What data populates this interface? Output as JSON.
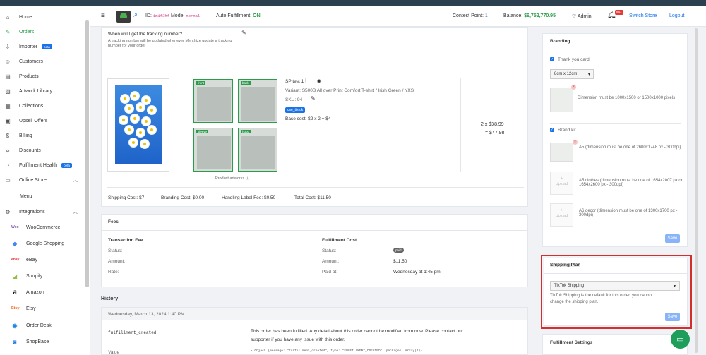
{
  "sidebar": {
    "items": [
      {
        "label": "Home",
        "icon": "home-icon"
      },
      {
        "label": "Orders",
        "icon": "edit-icon",
        "active": true
      },
      {
        "label": "Importer",
        "icon": "import-icon",
        "badge": "beta"
      },
      {
        "label": "Customers",
        "icon": "user-icon"
      },
      {
        "label": "Products",
        "icon": "box-icon"
      },
      {
        "label": "Artwork Library",
        "icon": "image-icon"
      },
      {
        "label": "Collections",
        "icon": "collection-icon"
      },
      {
        "label": "Upsell Offers",
        "icon": "cart-icon"
      },
      {
        "label": "Billing",
        "icon": "dollar-icon"
      },
      {
        "label": "Discounts",
        "icon": "tag-icon"
      },
      {
        "label": "Fulfillment Health",
        "icon": "health-icon",
        "badge": "beta"
      },
      {
        "label": "Online Store",
        "icon": "store-icon",
        "expanded": true
      },
      {
        "label": "Menu",
        "sub": true
      },
      {
        "label": "Integrations",
        "icon": "integrations-icon",
        "expanded": true
      },
      {
        "label": "WooCommerce",
        "icon": "woocommerce-icon"
      },
      {
        "label": "Google Shopping",
        "icon": "google-shopping-icon"
      },
      {
        "label": "eBay",
        "icon": "ebay-icon"
      },
      {
        "label": "Shopify",
        "icon": "shopify-icon"
      },
      {
        "label": "Amazon",
        "icon": "amazon-icon"
      },
      {
        "label": "Etsy",
        "icon": "etsy-icon"
      },
      {
        "label": "Order Desk",
        "icon": "orderdesk-icon"
      },
      {
        "label": "ShopBase",
        "icon": "shopbase-icon"
      }
    ]
  },
  "topbar": {
    "id_label": "ID:",
    "id_value": "1m1f3hf",
    "mode_label": "Mode:",
    "mode_value": "normal",
    "auto_label": "Auto Fulfillment:",
    "auto_value": "ON",
    "contest_label": "Contest Point:",
    "contest_value": "1",
    "balance_label": "Balance:",
    "balance_value": "$9,752,770.95",
    "admin": "Admin",
    "notif_badge": "99+",
    "switch_store": "Switch Store",
    "logout": "Logout"
  },
  "tracking": {
    "question": "When will I get the tracking number?",
    "note_line1": "A tracking number will be updated whenever Merchize update a tracking",
    "note_line2": "number for your order"
  },
  "product": {
    "name": "SP test 1",
    "variant": "Variant: S500B All over Print Comfort T-shirt / Irish Green / YXS",
    "sku": "SKU: 94",
    "tag": "cse_tiktok",
    "base_cost": "Base cost: $2 x 2 = $4",
    "artworks": [
      {
        "label": "front"
      },
      {
        "label": "back"
      },
      {
        "label": "sleeve"
      },
      {
        "label": "hood"
      }
    ],
    "artworks_caption": "Product artworks ⓘ",
    "qty_price": "2 x $38.99",
    "total": "= $77.98"
  },
  "costs": {
    "shipping": "Shipping Cost: $7",
    "branding": "Branding Cost: $0.00",
    "handling": "Handling Label Fee: $0.50",
    "total": "Total Cost: $11.50"
  },
  "fees": {
    "title": "Fees",
    "transaction": {
      "title": "Transaction Fee",
      "status_label": "Status:",
      "status_value": "-",
      "amount_label": "Amount:",
      "rate_label": "Rate:"
    },
    "fulfillment": {
      "title": "Fulfillment Cost",
      "status_label": "Status:",
      "status_value": "paid",
      "amount_label": "Amount:",
      "amount_value": "$11.50",
      "paid_label": "Paid at:",
      "paid_value": "Wednesday at 1:45 pm"
    }
  },
  "history": {
    "title": "History",
    "date": "Wednesday, March 13, 2024 1:40 PM",
    "event": "fulfillment_created",
    "message_line1": "This order has been fulfilled. Any detail about this order cannot be modified from now. Please contact our",
    "message_line2": "supporter if you have any issue with this order.",
    "value_label": "Value",
    "value_text": "▸ Object {message: \"fulfillment_created\", type: \"FULFILLMENT_CREATED\", packages: Array(1)}"
  },
  "branding": {
    "title": "Branding",
    "thank_you_label": "Thank you card",
    "size_option": "8cm x 12cm",
    "thank_dim": "Dimension must be 1000x1500 or 1500x1000 pixels",
    "brand_kit_label": "Brand kit",
    "a5": "A5 (dimension must be one of 2600x1748 px - 300dpi)",
    "a5_clothes": "A5 clothes (dimension must be one of 1654x2007 px or 1654x2600 px - 300dpi)",
    "a6_decor": "A6 decor (dimension must be one of 1300x1700 px - 300dpi)",
    "upload_label": "Upload",
    "save": "Save"
  },
  "shipping_plan": {
    "title": "Shipping Plan",
    "selected": "TikTok Shipping",
    "note_line1": "TikTok Shipping is the default for this order, you cannot",
    "note_line2": "change the shipping plan.",
    "save": "Save"
  },
  "fulfillment_settings": {
    "title": "Fulfillment Settings"
  },
  "colors": {
    "accent_green": "#2a9d4a",
    "link_blue": "#1a73e8",
    "highlight_red": "#d32f2f"
  }
}
